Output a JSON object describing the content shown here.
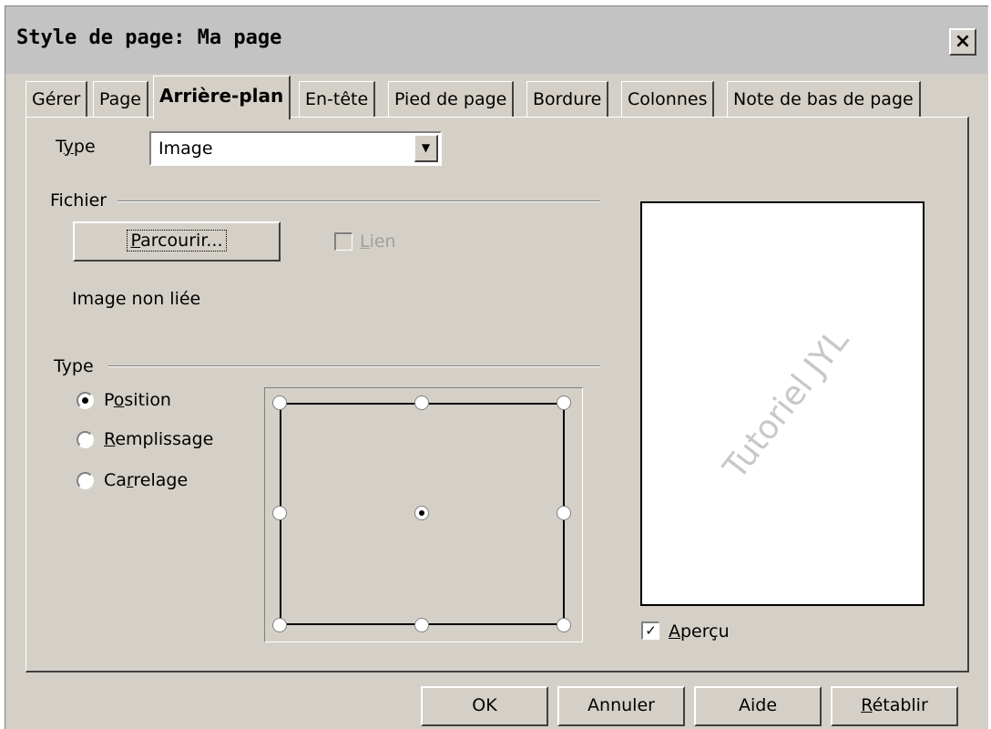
{
  "window": {
    "title": "Style de page: Ma page",
    "close_label": "×"
  },
  "tabs": [
    {
      "label": "Gérer"
    },
    {
      "label": "Page"
    },
    {
      "label": "Arrière-plan"
    },
    {
      "label": "En-tête"
    },
    {
      "label": "Pied de page"
    },
    {
      "label": "Bordure"
    },
    {
      "label": "Colonnes"
    },
    {
      "label": "Note de bas de page"
    }
  ],
  "active_tab": "Arrière-plan",
  "background": {
    "type_label_pre": "T",
    "type_label_u": "y",
    "type_label_post": "pe",
    "type_value": "Image",
    "file_group_label": "Fichier",
    "browse_u": "P",
    "browse_rest": "arcourir...",
    "link_u": "L",
    "link_rest": "ien",
    "link_checked": false,
    "link_enabled": false,
    "status_text": "Image non liée",
    "kind_group_label": "Type",
    "options": {
      "position": {
        "pre": "P",
        "u": "o",
        "post": "sition",
        "checked": true
      },
      "fill": {
        "pre": "",
        "u": "R",
        "post": "emplissage",
        "checked": false
      },
      "tile": {
        "pre": "Ca",
        "u": "r",
        "post": "relage",
        "checked": false
      }
    },
    "selected_anchor": "center",
    "preview_watermark": "Tutoriel JYL",
    "preview_u": "A",
    "preview_rest": "perçu",
    "preview_checked": true
  },
  "footer": {
    "ok": "OK",
    "cancel": "Annuler",
    "help": "Aide",
    "reset_u": "R",
    "reset_rest": "établir"
  },
  "icons": {
    "close": "close-icon",
    "dropdown": "chevron-down-icon",
    "cursor": "mouse-pointer-icon"
  },
  "colors": {
    "dialog_bg": "#d4d0c8",
    "titlebar_bg": "#c3c3c3",
    "watermark": "#c8c8c8"
  }
}
